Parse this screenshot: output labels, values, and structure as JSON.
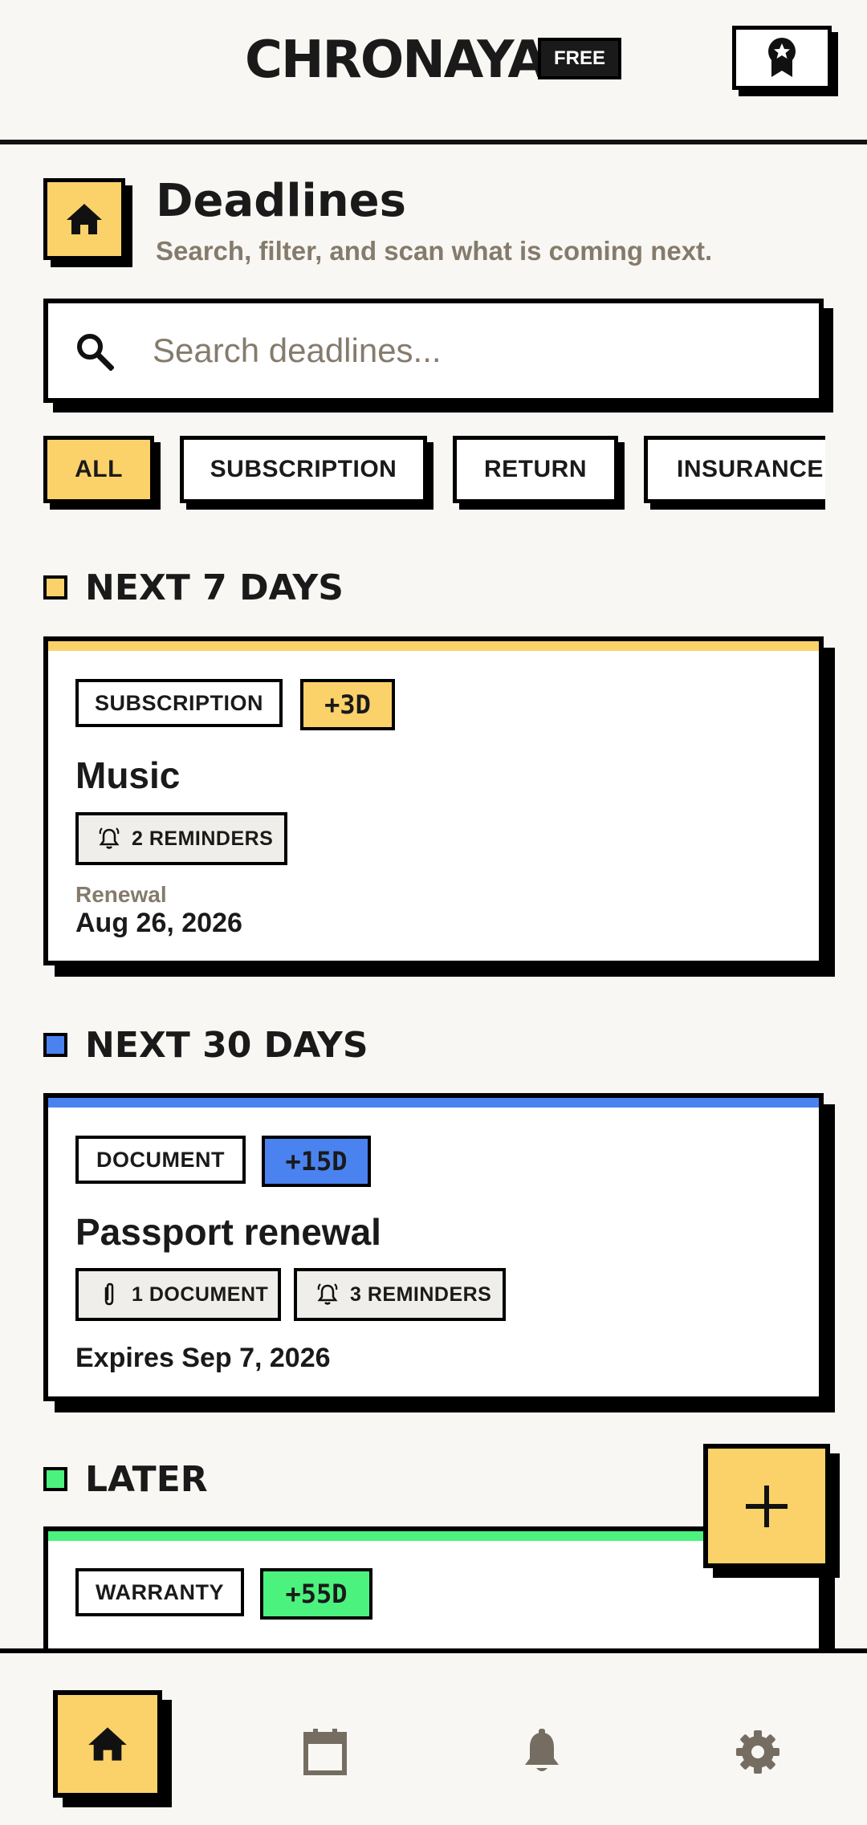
{
  "header": {
    "brand": "CHRONAYA",
    "plan_badge": "FREE",
    "award_icon": "award-ribbon-icon"
  },
  "page": {
    "icon": "home-icon",
    "title": "Deadlines",
    "subtitle": "Search, filter, and scan what is coming next."
  },
  "search": {
    "placeholder": "Search deadlines..."
  },
  "filters": [
    {
      "label": "ALL",
      "active": true
    },
    {
      "label": "SUBSCRIPTION",
      "active": false
    },
    {
      "label": "RETURN",
      "active": false
    },
    {
      "label": "INSURANCE",
      "active": false
    }
  ],
  "sections": [
    {
      "title": "NEXT 7 DAYS",
      "color": "#fbd26a",
      "cards": [
        {
          "tag": "SUBSCRIPTION",
          "due": "+3D",
          "due_color": "#fbd26a",
          "title": "Music",
          "meta": [
            {
              "icon": "bell-ring-icon",
              "text": "2 REMINDERS"
            }
          ],
          "date_label": "Renewal",
          "date": "Aug 26, 2026"
        }
      ]
    },
    {
      "title": "NEXT 30 DAYS",
      "color": "#4a82f0",
      "cards": [
        {
          "tag": "DOCUMENT",
          "due": "+15D",
          "due_color": "#4a82f0",
          "title": "Passport renewal",
          "meta": [
            {
              "icon": "paperclip-icon",
              "text": "1 DOCUMENT"
            },
            {
              "icon": "bell-ring-icon",
              "text": "3 REMINDERS"
            }
          ],
          "date": "Expires Sep 7, 2026"
        }
      ]
    },
    {
      "title": "LATER",
      "color": "#4cf27e",
      "cards": [
        {
          "tag": "WARRANTY",
          "due": "+55D",
          "due_color": "#4cf27e"
        }
      ]
    }
  ],
  "fab_icon": "plus-icon",
  "bottom_nav": [
    {
      "name": "home",
      "icon": "home-icon",
      "active": true
    },
    {
      "name": "calendar",
      "icon": "calendar-icon",
      "active": false
    },
    {
      "name": "notifications",
      "icon": "bell-icon",
      "active": false
    },
    {
      "name": "settings",
      "icon": "gear-icon",
      "active": false
    }
  ]
}
